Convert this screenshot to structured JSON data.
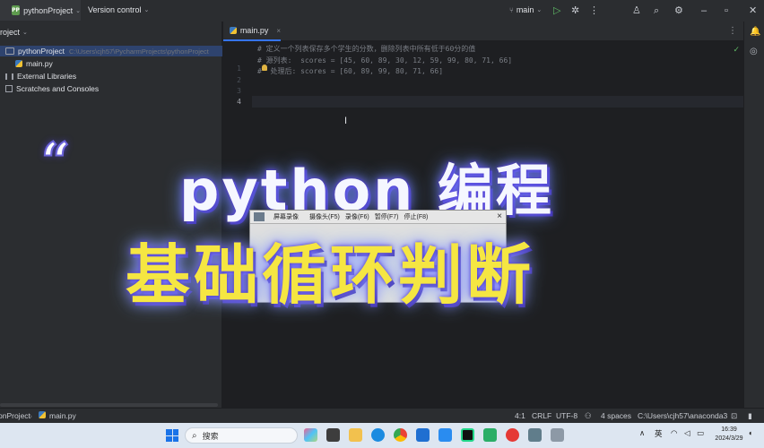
{
  "titlebar": {
    "project_badge": "PP",
    "project_name": "pythonProject",
    "version_control": "Version control",
    "branch": "main"
  },
  "project_panel": {
    "header": "roject",
    "items": [
      {
        "label": "pythonProject",
        "path": "C:\\Users\\cjh57\\PycharmProjects\\pythonProject"
      },
      {
        "label": "main.py"
      },
      {
        "label": "External Libraries"
      },
      {
        "label": "Scratches and Consoles"
      }
    ]
  },
  "editor": {
    "tab_label": "main.py",
    "tab_close": "×",
    "line_numbers": [
      "1",
      "2",
      "3",
      "4"
    ],
    "lines": [
      "# 定义一个列表保存多个学生的分数，删除列表中所有低于60分的值",
      "# 源列表:  scores = [45, 60, 89, 30, 12, 59, 99, 80, 71, 66]",
      "#  处理后: scores = [60, 89, 99, 80, 71, 66]",
      ""
    ]
  },
  "overlay": {
    "quote": "“",
    "title_line1": "python 编程",
    "title_line2": "基础循环判断",
    "recorder_items": [
      "屏幕录像",
      "摄像头(F5)",
      "录像(F6)",
      "暂停(F7)",
      "停止(F8)"
    ],
    "recorder_close": "×"
  },
  "status_bar": {
    "breadcrumb_project": "pnProject",
    "breadcrumb_file": "main.py",
    "position": "4:1",
    "line_ending": "CRLF",
    "encoding": "UTF-8",
    "indent": "4 spaces",
    "interpreter": "C:\\Users\\cjh57\\anaconda3"
  },
  "taskbar": {
    "search_placeholder": "搜索",
    "ime": "英",
    "time": "16:39",
    "date": "2024/3/29"
  }
}
